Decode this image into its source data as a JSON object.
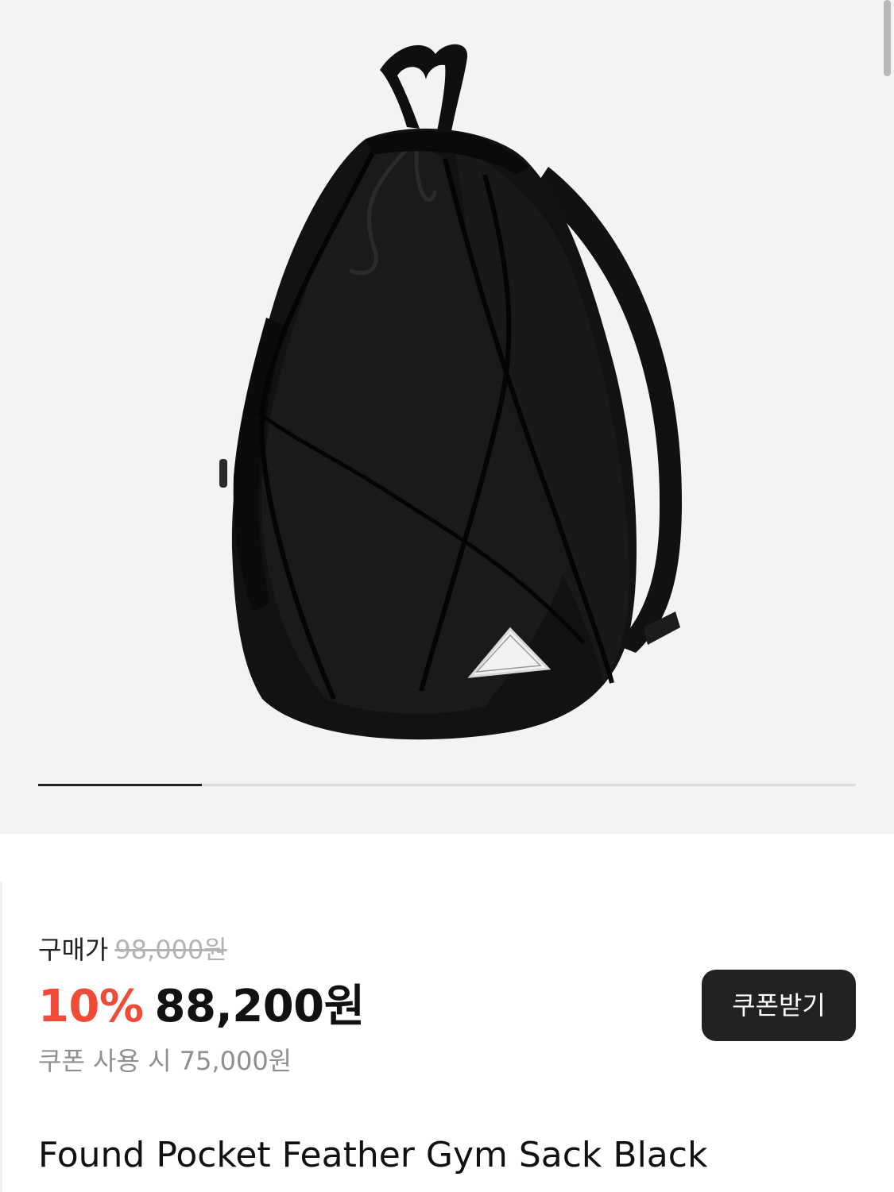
{
  "gallery": {
    "image_subject": "black drawstring gym sack backpack with mesh front panel and triangular logo patch",
    "pager": {
      "current": 1,
      "total": 5
    }
  },
  "price": {
    "label": "구매가",
    "original_price": "98,000원",
    "discount_rate": "10%",
    "sale_price": "88,200원",
    "coupon_price_text": "쿠폰 사용 시 75,000원"
  },
  "coupon_button": {
    "label": "쿠폰받기"
  },
  "product": {
    "name": "Found Pocket Feather Gym Sack Black"
  },
  "colors": {
    "discount": "#ef4b37",
    "button_bg": "#222222",
    "gallery_bg": "#f3f3f3"
  }
}
